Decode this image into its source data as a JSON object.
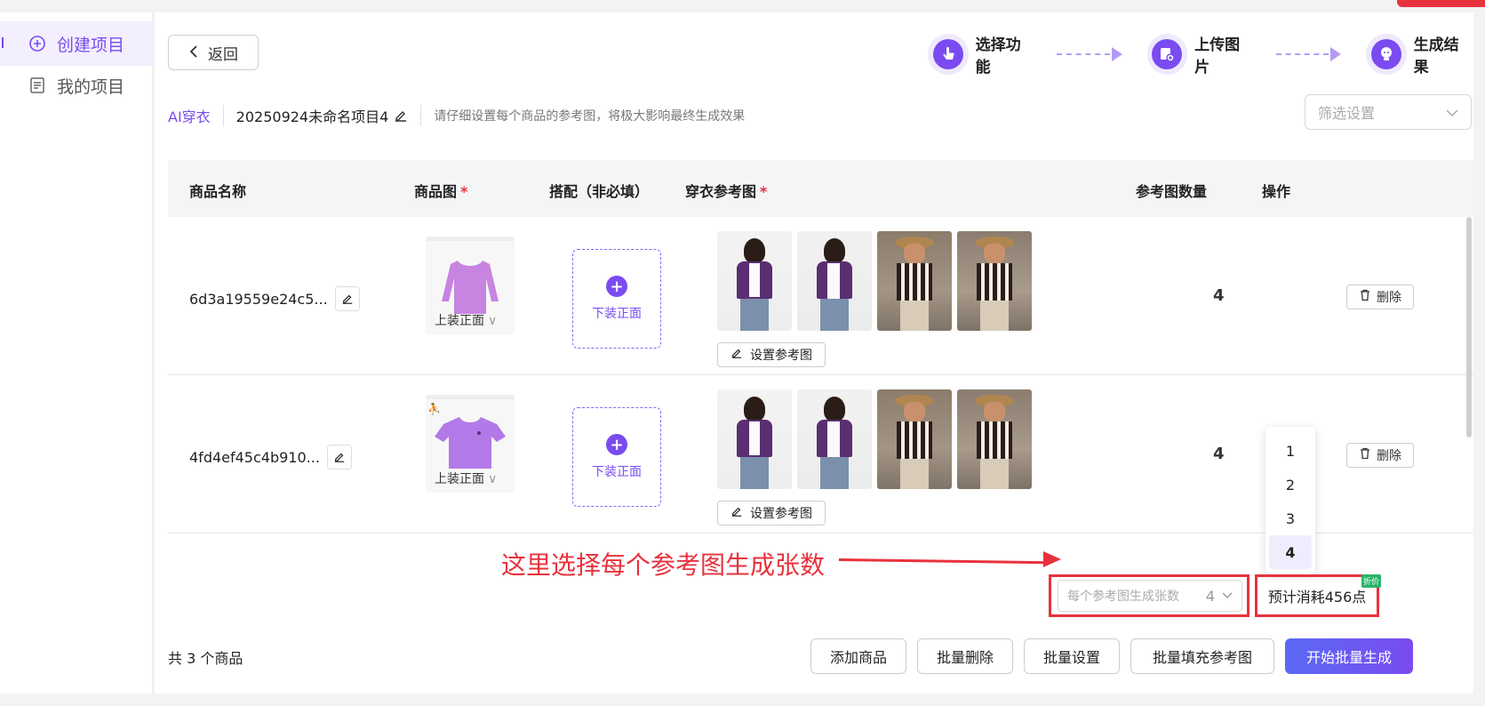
{
  "sidebar": {
    "items": [
      {
        "label": "创建项目",
        "active": true,
        "icon": "plus-circle-icon"
      },
      {
        "label": "我的项目",
        "active": false,
        "icon": "document-icon"
      }
    ]
  },
  "header": {
    "back_label": "返回",
    "steps": [
      {
        "label": "选择功能",
        "icon": "touch-icon"
      },
      {
        "label": "上传图片",
        "icon": "upload-image-icon"
      },
      {
        "label": "生成结果",
        "icon": "bulb-icon"
      }
    ]
  },
  "project": {
    "tag": "AI穿衣",
    "name": "20250924未命名项目4",
    "hint": "请仔细设置每个商品的参考图，将极大影响最终生成效果"
  },
  "filter": {
    "placeholder": "筛选设置"
  },
  "table": {
    "columns": {
      "name": "商品名称",
      "image": "商品图",
      "match": "搭配（非必填）",
      "ref": "穿衣参考图",
      "count": "参考图数量",
      "ops": "操作"
    },
    "rows": [
      {
        "name": "6d3a19559e24c5...",
        "product_label": "上装正面",
        "match_label": "下装正面",
        "set_ref_label": "设置参考图",
        "ref_count": "4",
        "delete_label": "删除"
      },
      {
        "name": "4fd4ef45c4b910...",
        "product_label": "上装正面",
        "match_label": "下装正面",
        "set_ref_label": "设置参考图",
        "ref_count": "4",
        "delete_label": "删除"
      }
    ]
  },
  "dropdown": {
    "options": [
      "1",
      "2",
      "3",
      "4"
    ],
    "selected": "4"
  },
  "annotation": {
    "text": "这里选择每个参考图生成张数"
  },
  "per_ref_select": {
    "placeholder": "每个参考图生成张数",
    "value": "4"
  },
  "cost": {
    "label": "预计消耗456点",
    "badge": "折价"
  },
  "footer": {
    "total": "共 3 个商品",
    "buttons": [
      "添加商品",
      "批量删除",
      "批量设置",
      "批量填充参考图"
    ],
    "primary": "开始批量生成"
  },
  "colors": {
    "accent": "#7a4bf0",
    "annotation": "#e8323d"
  }
}
